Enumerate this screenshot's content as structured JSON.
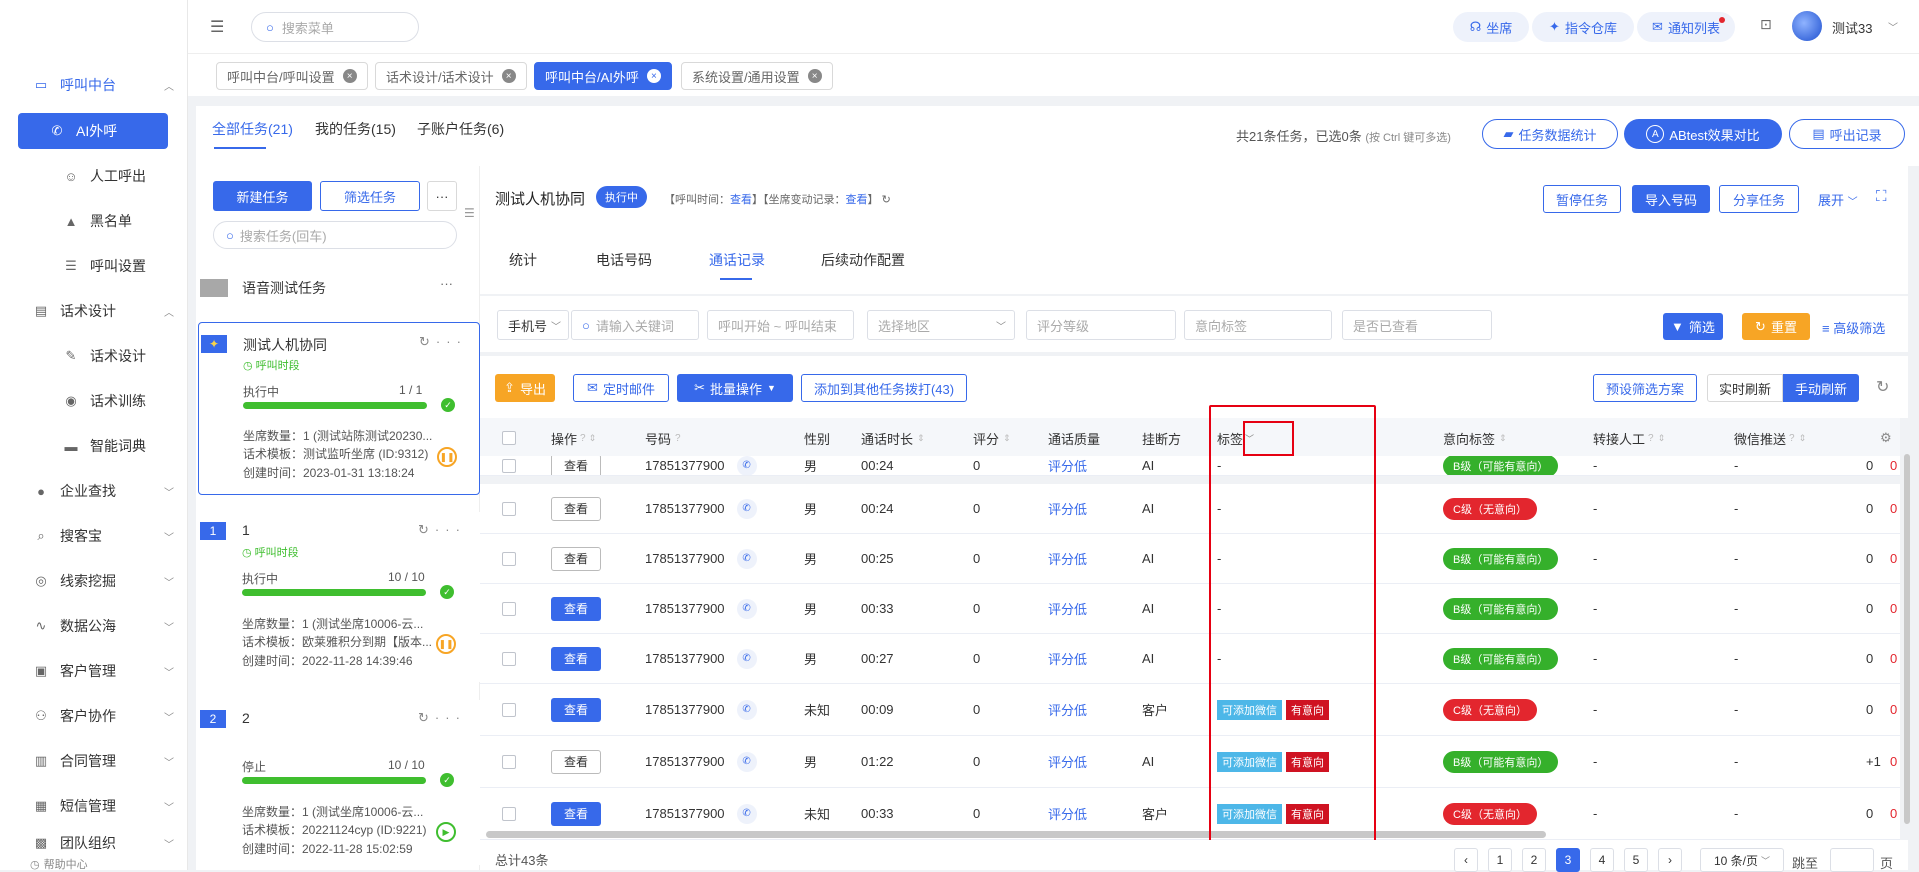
{
  "sidebar": {
    "items": [
      {
        "label": "呼叫中台",
        "icon": "monitor-icon"
      },
      {
        "label": "AI外呼",
        "icon": "phone-icon"
      },
      {
        "label": "人工呼出",
        "icon": "agent-icon"
      },
      {
        "label": "黑名单",
        "icon": "warning-icon"
      },
      {
        "label": "呼叫设置",
        "icon": "sliders-icon"
      },
      {
        "label": "话术设计",
        "icon": "script-icon"
      },
      {
        "label": "话术设计",
        "icon": "pen-icon"
      },
      {
        "label": "话术训练",
        "icon": "chat-icon"
      },
      {
        "label": "智能词典",
        "icon": "book-icon"
      },
      {
        "label": "企业查找",
        "icon": "bulb-icon"
      },
      {
        "label": "搜客宝",
        "icon": "magnifier-icon"
      },
      {
        "label": "线索挖掘",
        "icon": "target-icon"
      },
      {
        "label": "数据公海",
        "icon": "wave-icon"
      },
      {
        "label": "客户管理",
        "icon": "customer-icon"
      },
      {
        "label": "客户协作",
        "icon": "collab-icon"
      },
      {
        "label": "合同管理",
        "icon": "clipboard-icon"
      },
      {
        "label": "短信管理",
        "icon": "sms-icon"
      },
      {
        "label": "团队组织",
        "icon": "team-icon"
      }
    ],
    "help": "帮助中心"
  },
  "topbar": {
    "search_placeholder": "搜索菜单",
    "seat": "坐席",
    "warehouse": "指令仓库",
    "notify": "通知列表",
    "username": "测试33"
  },
  "tags": [
    {
      "label": "呼叫中台/呼叫设置"
    },
    {
      "label": "话术设计/话术设计"
    },
    {
      "label": "呼叫中台/AI外呼"
    },
    {
      "label": "系统设置/通用设置"
    }
  ],
  "tabs": {
    "all": "全部任务(21)",
    "mine": "我的任务(15)",
    "sub": "子账户任务(6)"
  },
  "summary": {
    "text": "共21条任务，已选0条",
    "hint": "(按 Ctrl 键可多选)",
    "stats_btn": "任务数据统计",
    "ab_btn": "ABtest效果对比",
    "records_btn": "呼出记录"
  },
  "leftpanel": {
    "new_btn": "新建任务",
    "filter_btn": "筛选任务",
    "more": "···",
    "search_placeholder": "搜索任务(回车)",
    "group": "语音测试任务",
    "group_more": "···"
  },
  "cards": [
    {
      "num": "",
      "title": "测试人机协同",
      "segment": "呼叫时段",
      "status": "执行中",
      "progress": "1 / 1",
      "seats": "坐席数量：1 (测试站陈测试20230...",
      "template": "话术模板：测试监听坐席 (ID:9312)",
      "created": "创建时间：2023-01-31 13:18:24"
    },
    {
      "num": "1",
      "title": "1",
      "segment": "呼叫时段",
      "status": "执行中",
      "progress": "10 / 10",
      "seats": "坐席数量：1 (测试坐席10006-云...",
      "template": "话术模板：欧莱雅积分到期【版本...",
      "created": "创建时间：2022-11-28 14:39:46"
    },
    {
      "num": "2",
      "title": "2",
      "segment": "",
      "status": "停止",
      "progress": "10 / 10",
      "seats": "坐席数量：1 (测试坐席10006-云...",
      "template": "话术模板：20221124cyp (ID:9221)",
      "created": "创建时间：2022-11-28 15:02:59"
    }
  ],
  "detail": {
    "title": "测试人机协同",
    "status": "执行中",
    "meta_prefix": "【呼叫时间：",
    "meta_link1": "查看",
    "meta_mid": "】【坐席变动记录：",
    "meta_link2": "查看",
    "meta_suffix": "】",
    "pause_btn": "暂停任务",
    "import_btn": "导入号码",
    "share_btn": "分享任务",
    "expand": "展开"
  },
  "subtabs": [
    "统计",
    "电话号码",
    "通话记录",
    "后续动作配置"
  ],
  "filters": {
    "phone_type": "手机号",
    "keyword": "请输入关键词",
    "daterange": "呼叫开始 ~ 呼叫结束",
    "region": "选择地区",
    "grade": "评分等级",
    "intent": "意向标签",
    "viewed": "是否已查看",
    "filter_btn": "筛选",
    "reset_btn": "重置",
    "advanced": "高级筛选"
  },
  "toolbar": {
    "export": "导出",
    "mail": "定时邮件",
    "batch": "批量操作",
    "add_other": "添加到其他任务拨打(43)",
    "preset": "预设筛选方案",
    "realtime": "实时刷新",
    "manual": "手动刷新"
  },
  "columns": [
    "操作",
    "号码",
    "性别",
    "通话时长",
    "评分",
    "通话质量",
    "挂断方",
    "标签",
    "意向标签",
    "转接人工",
    "微信推送"
  ],
  "rows": [
    {
      "view": "查看",
      "vstyle": "w",
      "phone": "17851377900",
      "gender": "男",
      "dur": "00:24",
      "score": "0",
      "qual": "评分低",
      "hang": "AI",
      "tags": [],
      "intent": "B级（可能有意向）",
      "ic": "b",
      "transfer": "-",
      "wx": "-",
      "last": "0"
    },
    {
      "view": "查看",
      "vstyle": "w",
      "phone": "17851377900",
      "gender": "男",
      "dur": "00:24",
      "score": "0",
      "qual": "评分低",
      "hang": "AI",
      "tags": [],
      "intent": "C级（无意向）",
      "ic": "c",
      "transfer": "-",
      "wx": "-",
      "last": "0"
    },
    {
      "view": "查看",
      "vstyle": "w",
      "phone": "17851377900",
      "gender": "男",
      "dur": "00:25",
      "score": "0",
      "qual": "评分低",
      "hang": "AI",
      "tags": [],
      "intent": "B级（可能有意向）",
      "ic": "b",
      "transfer": "-",
      "wx": "-",
      "last": "0"
    },
    {
      "view": "查看",
      "vstyle": "b",
      "phone": "17851377900",
      "gender": "男",
      "dur": "00:33",
      "score": "0",
      "qual": "评分低",
      "hang": "AI",
      "tags": [],
      "intent": "B级（可能有意向）",
      "ic": "b",
      "transfer": "-",
      "wx": "-",
      "last": "0"
    },
    {
      "view": "查看",
      "vstyle": "b",
      "phone": "17851377900",
      "gender": "男",
      "dur": "00:27",
      "score": "0",
      "qual": "评分低",
      "hang": "AI",
      "tags": [],
      "intent": "B级（可能有意向）",
      "ic": "b",
      "transfer": "-",
      "wx": "-",
      "last": "0"
    },
    {
      "view": "查看",
      "vstyle": "b",
      "phone": "17851377900",
      "gender": "未知",
      "dur": "00:09",
      "score": "0",
      "qual": "评分低",
      "hang": "客户",
      "tags": [
        "可添加微信",
        "有意向"
      ],
      "intent": "C级（无意向）",
      "ic": "c",
      "transfer": "-",
      "wx": "-",
      "last": "0"
    },
    {
      "view": "查看",
      "vstyle": "w",
      "phone": "17851377900",
      "gender": "男",
      "dur": "01:22",
      "score": "0",
      "qual": "评分低",
      "hang": "AI",
      "tags": [
        "可添加微信",
        "有意向"
      ],
      "intent": "B级（可能有意向）",
      "ic": "b",
      "transfer": "-",
      "wx": "-",
      "last": "+1"
    },
    {
      "view": "查看",
      "vstyle": "b",
      "phone": "17851377900",
      "gender": "未知",
      "dur": "00:33",
      "score": "0",
      "qual": "评分低",
      "hang": "客户",
      "tags": [
        "可添加微信",
        "有意向"
      ],
      "intent": "C级（无意向）",
      "ic": "c",
      "transfer": "-",
      "wx": "-",
      "last": "0"
    }
  ],
  "footer": {
    "total": "总计43条",
    "pages": [
      "1",
      "2",
      "3",
      "4",
      "5"
    ],
    "current": "3",
    "page_size": "10 条/页",
    "jump": "跳至",
    "page_unit": "页"
  },
  "colors": {
    "primary": "#3769ea",
    "warn": "#f7a525",
    "success": "#3fbe2f",
    "danger": "#e3262e",
    "highlight": "#e60012"
  }
}
